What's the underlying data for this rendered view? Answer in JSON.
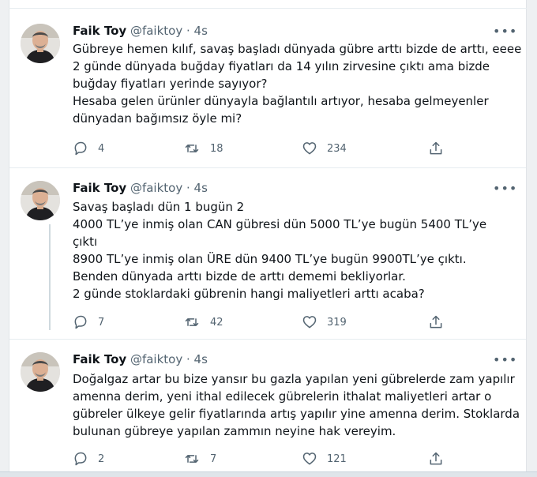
{
  "tweets": [
    {
      "author": "Faik Toy",
      "handle": "@faiktoy",
      "time": "· 4s",
      "lines": [
        "Gübreye hemen kılıf, savaş başladı dünyada gübre arttı bizde de arttı, eeee",
        "2 günde dünyada buğday fiyatları da 14 yılın zirvesine çıktı ama bizde",
        "buğday fiyatları yerinde sayıyor?",
        "Hesaba gelen ürünler dünyayla bağlantılı artıyor, hesaba gelmeyenler",
        "dünyadan bağımsız öyle mi?"
      ],
      "replies": "4",
      "retweets": "18",
      "likes": "234"
    },
    {
      "author": "Faik Toy",
      "handle": "@faiktoy",
      "time": "· 4s",
      "lines": [
        "Savaş başladı dün 1 bugün 2",
        "4000 TL’ye inmiş olan CAN gübresi dün 5000 TL’ye bugün 5400 TL’ye",
        "çıktı",
        "8900 TL’ye inmiş olan ÜRE dün 9400 TL’ye bugün 9900TL’ye çıktı.",
        "Benden dünyada arttı bizde de arttı dememi bekliyorlar.",
        "2 günde stoklardaki gübrenin hangi maliyetleri arttı acaba?"
      ],
      "replies": "7",
      "retweets": "42",
      "likes": "319"
    },
    {
      "author": "Faik Toy",
      "handle": "@faiktoy",
      "time": "· 4s",
      "lines": [
        "Doğalgaz artar bu bize yansır bu gazla yapılan yeni gübrelerde zam yapılır",
        "amenna derim, yeni ithal edilecek gübrelerin ithalat maliyetleri artar o",
        "gübreler ülkeye gelir fiyatlarında artış yapılır yine amenna derim. Stoklarda",
        "bulunan gübreye yapılan zammın neyine hak vereyim."
      ],
      "replies": "2",
      "retweets": "7",
      "likes": "121"
    }
  ],
  "icons": {
    "more": "more-dots-icon",
    "reply": "reply-icon",
    "retweet": "retweet-icon",
    "like": "heart-icon",
    "share": "share-icon"
  },
  "colors": {
    "text": "#0f1419",
    "secondary": "#536471",
    "divider": "#e6ecf0",
    "thread": "#cfd9de"
  }
}
